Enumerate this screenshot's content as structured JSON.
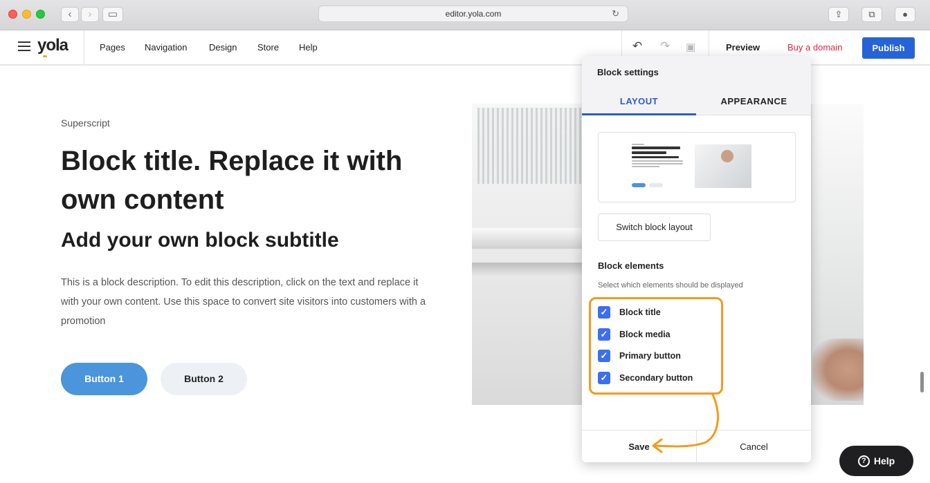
{
  "browser": {
    "url": "editor.yola.com",
    "back_icon": "chevron-left-icon",
    "forward_icon": "chevron-right-icon",
    "sidebar_icon": "sidebar-icon"
  },
  "editor": {
    "logo": "yola",
    "menu": [
      "Pages",
      "Navigation",
      "Design",
      "Store",
      "Help"
    ],
    "preview_label": "Preview",
    "buy_domain_label": "Buy a domain",
    "publish_label": "Publish",
    "accent_color": "#2663d6",
    "buy_domain_color": "#e0254a"
  },
  "block": {
    "superscript": "Superscript",
    "title": "Block title. Replace it with own content",
    "subtitle": "Add your own block subtitle",
    "description": "This is a block description. To edit this description, click on the text and replace it with your own content. Use this space to convert site visitors into customers with a promotion",
    "button1": "Button 1",
    "button2": "Button 2"
  },
  "settings_panel": {
    "title": "Block settings",
    "tabs": [
      {
        "label": "LAYOUT",
        "active": true
      },
      {
        "label": "APPEARANCE",
        "active": false
      }
    ],
    "switch_layout_label": "Switch block layout",
    "elements_title": "Block elements",
    "elements_hint": "Select which elements should be displayed",
    "elements": [
      {
        "label": "Block title",
        "checked": true
      },
      {
        "label": "Block media",
        "checked": true
      },
      {
        "label": "Primary button",
        "checked": true
      },
      {
        "label": "Secondary button",
        "checked": true
      }
    ],
    "save_label": "Save",
    "cancel_label": "Cancel",
    "highlight_color": "#f29b1c"
  },
  "help": {
    "label": "Help"
  }
}
